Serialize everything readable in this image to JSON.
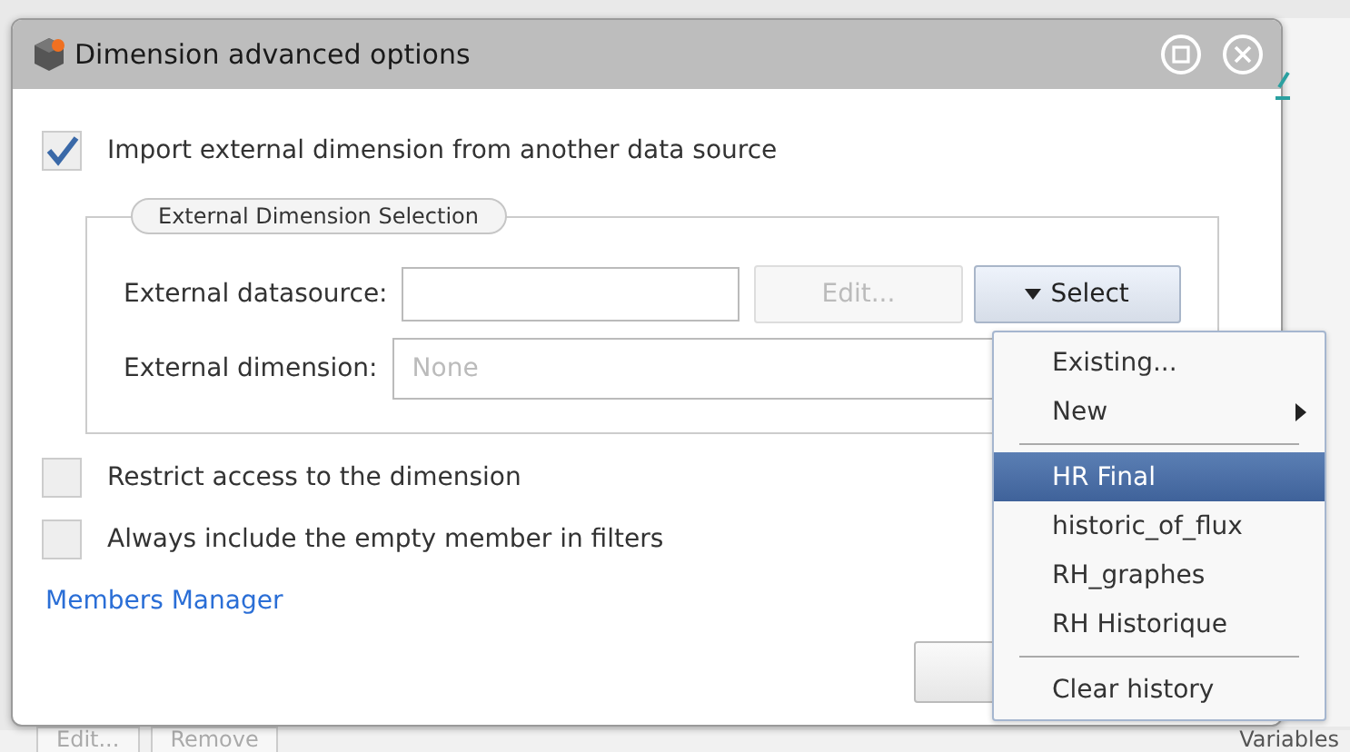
{
  "window": {
    "title": "Dimension advanced options"
  },
  "import_option": {
    "label": "Import external dimension from another data source",
    "checked": true
  },
  "selection": {
    "legend": "External Dimension Selection",
    "datasource": {
      "label": "External datasource:"
    },
    "edit_button": {
      "label": "Edit...",
      "disabled": true
    },
    "select_button": {
      "label": "Select"
    },
    "dimension": {
      "label": "External dimension:",
      "placeholder": "None"
    }
  },
  "options": [
    {
      "label": "Restrict access to the dimension",
      "checked": false
    },
    {
      "label": "Always include the empty member in filters",
      "checked": false
    }
  ],
  "link": "Members Manager",
  "menu": [
    {
      "kind": "item",
      "label": "Existing...",
      "selected": false,
      "submenu": false
    },
    {
      "kind": "item",
      "label": "New",
      "selected": false,
      "submenu": true
    },
    {
      "kind": "separator"
    },
    {
      "kind": "item",
      "label": "HR Final",
      "selected": true,
      "submenu": false
    },
    {
      "kind": "item",
      "label": "historic_of_flux",
      "selected": false,
      "submenu": false
    },
    {
      "kind": "item",
      "label": "RH_graphes",
      "selected": false,
      "submenu": false
    },
    {
      "kind": "item",
      "label": "RH Historique",
      "selected": false,
      "submenu": false
    },
    {
      "kind": "separator"
    },
    {
      "kind": "item",
      "label": "Clear history",
      "selected": false,
      "submenu": false
    }
  ],
  "background": {
    "buttons": [
      "Edit...",
      "Remove"
    ],
    "section": "Variables"
  }
}
